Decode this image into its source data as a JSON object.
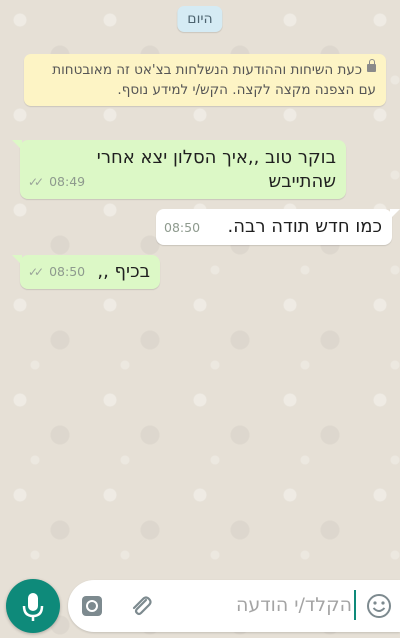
{
  "date_separator": "היום",
  "system_message": "כעת השיחות וההודעות הנשלחות בצ'אט זה מאובטחות עם הצפנה מקצה לקצה. הקש/י למידע נוסף.",
  "messages": [
    {
      "direction": "in",
      "text": "בוקר טוב ,,איך הסלון יצא אחרי שהתייבש",
      "time": "08:49",
      "status": "read-ticks"
    },
    {
      "direction": "out",
      "text": "כמו חדש תודה רבה.",
      "time": "08:50"
    },
    {
      "direction": "in",
      "text": "בכיף ,,",
      "time": "08:50",
      "status": "read-ticks"
    }
  ],
  "composer": {
    "placeholder": "הקלד/י הודעה",
    "icons": [
      "emoji-icon",
      "attachment-icon",
      "camera-icon",
      "microphone-icon"
    ]
  },
  "colors": {
    "incoming_bubble": "#dcf8c6",
    "outgoing_bubble": "#ffffff",
    "system_note": "#fdf4c5",
    "date_chip": "#d5ebf4",
    "accent": "#0e8a7a"
  }
}
